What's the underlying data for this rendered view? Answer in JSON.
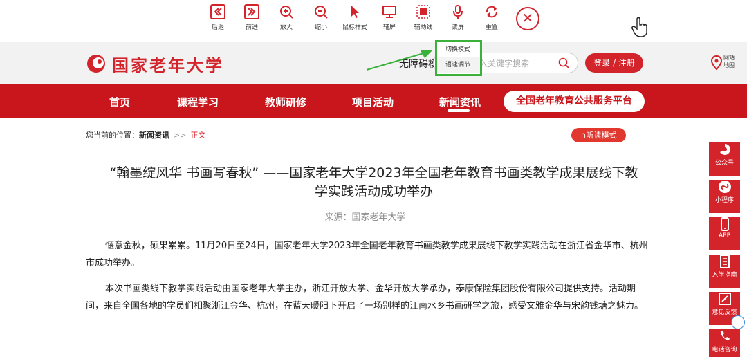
{
  "toolbar": {
    "items": [
      {
        "label": "后退",
        "icon": "back-icon"
      },
      {
        "label": "前进",
        "icon": "forward-icon"
      },
      {
        "label": "放大",
        "icon": "zoom-in-icon"
      },
      {
        "label": "缩小",
        "icon": "zoom-out-icon"
      },
      {
        "label": "鼠标样式",
        "icon": "cursor-icon"
      },
      {
        "label": "辅屏",
        "icon": "screen-icon"
      },
      {
        "label": "辅助线",
        "icon": "crosshair-icon"
      },
      {
        "label": "读屏",
        "icon": "microphone-icon"
      },
      {
        "label": "重置",
        "icon": "reset-icon"
      }
    ],
    "close_icon": "close-icon",
    "popup": [
      "切换模式",
      "语速调节"
    ]
  },
  "header": {
    "logo_text": "国家老年大学",
    "barrier_text": "无障碍模式",
    "search_placeholder": "输入关键字搜索",
    "login_label": "登录 / 注册",
    "map_label": "网站地图"
  },
  "nav": {
    "items": [
      "首页",
      "课程学习",
      "教师研修",
      "项目活动",
      "新闻资讯"
    ],
    "platform_label": "全国老年教育公共服务平台"
  },
  "breadcrumb": {
    "prefix": "您当前的位置：",
    "section": "新闻资讯",
    "separator": ">>",
    "current": "正文"
  },
  "listen_label": "∩听读模式",
  "article": {
    "title_line1": "“翰墨绽风华 书画写春秋” ——国家老年大学2023年全国老年教育书画类教学成果展线下教",
    "title_line2": "学实践活动成功举办",
    "source": "来源：国家老年大学",
    "paragraphs": [
      "惬意金秋，硕果累累。11月20日至24日，国家老年大学2023年全国老年教育书画类教学成果展线下教学实践活动在浙江省金华市、杭州市成功举办。",
      "本次书画类线下教学实践活动由国家老年大学主办，浙江开放大学、金华开放大学承办，泰康保险集团股份有限公司提供支持。活动期间，来自全国各地的学员们相聚浙江金华、杭州，在蓝天暖阳下开启了一场别样的江南水乡书画研学之旅，感受文雅金华与宋韵钱塘之魅力。"
    ]
  },
  "sidebar": {
    "items": [
      {
        "label": "公众号",
        "icon": "wechat-icon"
      },
      {
        "label": "小程序",
        "icon": "mini-program-icon"
      },
      {
        "label": "APP",
        "icon": "phone-icon"
      },
      {
        "label": "入学指南",
        "icon": "document-icon"
      },
      {
        "label": "意见反馈",
        "icon": "edit-icon"
      },
      {
        "label": "电话咨询",
        "icon": "telephone-icon"
      }
    ]
  },
  "colors": {
    "brand": "#c9161d",
    "highlight": "#3bb13b"
  }
}
